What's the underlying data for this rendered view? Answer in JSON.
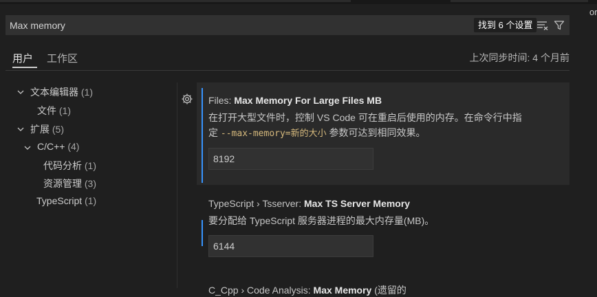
{
  "search": {
    "value": "Max memory",
    "result_count": "找到 6 个设置"
  },
  "edge_fragment": "or",
  "tabs": [
    {
      "label": "用户"
    },
    {
      "label": "工作区"
    }
  ],
  "sync_status": "上次同步时间: 4 个月前",
  "tree": {
    "text_editor": {
      "label": "文本编辑器",
      "count": "(1)"
    },
    "files": {
      "label": "文件",
      "count": "(1)"
    },
    "extensions": {
      "label": "扩展",
      "count": "(5)"
    },
    "cpp": {
      "label": "C/C++",
      "count": "(4)"
    },
    "code_analysis": {
      "label": "代码分析",
      "count": "(1)"
    },
    "resource_mgmt": {
      "label": "资源管理",
      "count": "(3)"
    },
    "typescript": {
      "label": "TypeScript",
      "count": "(1)"
    }
  },
  "settings": [
    {
      "category": "Files: ",
      "name": "Max Memory For Large Files MB",
      "desc_line1": "在打开大型文件时，控制 VS Code 可在重启后使用的内存。在命令行中指",
      "desc_line2_pre": "定 ",
      "desc_code": "--max-memory=新的大小",
      "desc_line2_post": " 参数可达到相同效果。",
      "value": "8192"
    },
    {
      "category": "TypeScript › Tsserver: ",
      "name": "Max TS Server Memory",
      "desc_line1": "要分配给 TypeScript 服务器进程的最大内存量(MB)。",
      "value": "6144"
    },
    {
      "category": "C_Cpp › Code Analysis: ",
      "name": "Max Memory",
      "desc_line1": "(遗留的"
    }
  ],
  "colors": {
    "accent": "#3794ff",
    "code": "#d7ba7d",
    "background": "#1f1f1f"
  }
}
